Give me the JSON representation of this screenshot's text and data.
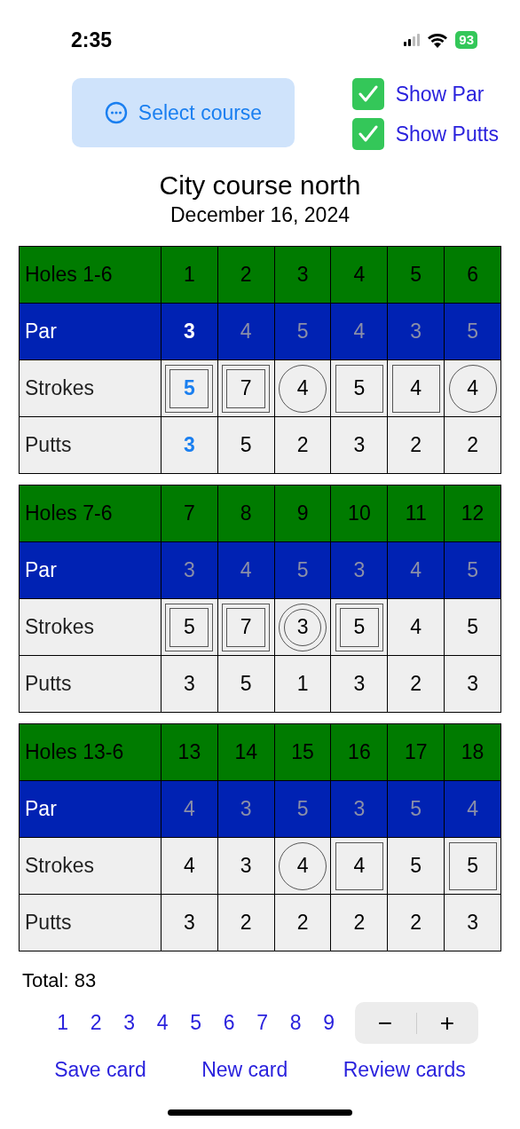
{
  "status_bar": {
    "time": "2:35",
    "battery": "93"
  },
  "select_course": {
    "label": "Select course"
  },
  "toggles": [
    {
      "label": "Show Par",
      "checked": true
    },
    {
      "label": "Show Putts",
      "checked": true
    }
  ],
  "course": {
    "name": "City course north",
    "date": "December 16, 2024"
  },
  "sections": [
    {
      "title": "Holes 1-6",
      "par_label": "Par",
      "strokes_label": "Strokes",
      "putts_label": "Putts",
      "holes": [
        {
          "number": "1",
          "par": "3",
          "strokes": "5",
          "putts": "3",
          "kind": "double_square",
          "selected": true
        },
        {
          "number": "2",
          "par": "4",
          "strokes": "7",
          "putts": "5",
          "kind": "double_square",
          "selected": false
        },
        {
          "number": "3",
          "par": "5",
          "strokes": "4",
          "putts": "2",
          "kind": "circle",
          "selected": false
        },
        {
          "number": "4",
          "par": "4",
          "strokes": "5",
          "putts": "3",
          "kind": "square",
          "selected": false
        },
        {
          "number": "5",
          "par": "3",
          "strokes": "4",
          "putts": "2",
          "kind": "square",
          "selected": false
        },
        {
          "number": "6",
          "par": "5",
          "strokes": "4",
          "putts": "2",
          "kind": "circle",
          "selected": false
        }
      ]
    },
    {
      "title": "Holes 7-6",
      "par_label": "Par",
      "strokes_label": "Strokes",
      "putts_label": "Putts",
      "holes": [
        {
          "number": "7",
          "par": "3",
          "strokes": "5",
          "putts": "3",
          "kind": "double_square",
          "selected": false
        },
        {
          "number": "8",
          "par": "4",
          "strokes": "7",
          "putts": "5",
          "kind": "double_square",
          "selected": false
        },
        {
          "number": "9",
          "par": "5",
          "strokes": "3",
          "putts": "1",
          "kind": "double_circle",
          "selected": false
        },
        {
          "number": "10",
          "par": "3",
          "strokes": "5",
          "putts": "3",
          "kind": "double_square",
          "selected": false
        },
        {
          "number": "11",
          "par": "4",
          "strokes": "4",
          "putts": "2",
          "kind": "plain",
          "selected": false
        },
        {
          "number": "12",
          "par": "5",
          "strokes": "5",
          "putts": "3",
          "kind": "plain",
          "selected": false
        }
      ]
    },
    {
      "title": "Holes 13-6",
      "par_label": "Par",
      "strokes_label": "Strokes",
      "putts_label": "Putts",
      "holes": [
        {
          "number": "13",
          "par": "4",
          "strokes": "4",
          "putts": "3",
          "kind": "plain",
          "selected": false
        },
        {
          "number": "14",
          "par": "3",
          "strokes": "3",
          "putts": "2",
          "kind": "plain",
          "selected": false
        },
        {
          "number": "15",
          "par": "5",
          "strokes": "4",
          "putts": "2",
          "kind": "circle",
          "selected": false
        },
        {
          "number": "16",
          "par": "3",
          "strokes": "4",
          "putts": "2",
          "kind": "square",
          "selected": false
        },
        {
          "number": "17",
          "par": "5",
          "strokes": "5",
          "putts": "2",
          "kind": "plain",
          "selected": false
        },
        {
          "number": "18",
          "par": "4",
          "strokes": "5",
          "putts": "3",
          "kind": "square",
          "selected": false
        }
      ]
    }
  ],
  "total": "Total: 83",
  "number_pad": [
    "1",
    "2",
    "3",
    "4",
    "5",
    "6",
    "7",
    "8",
    "9"
  ],
  "stepper": {
    "minus": "−",
    "plus": "+"
  },
  "actions": [
    "Save card",
    "New card",
    "Review cards"
  ]
}
